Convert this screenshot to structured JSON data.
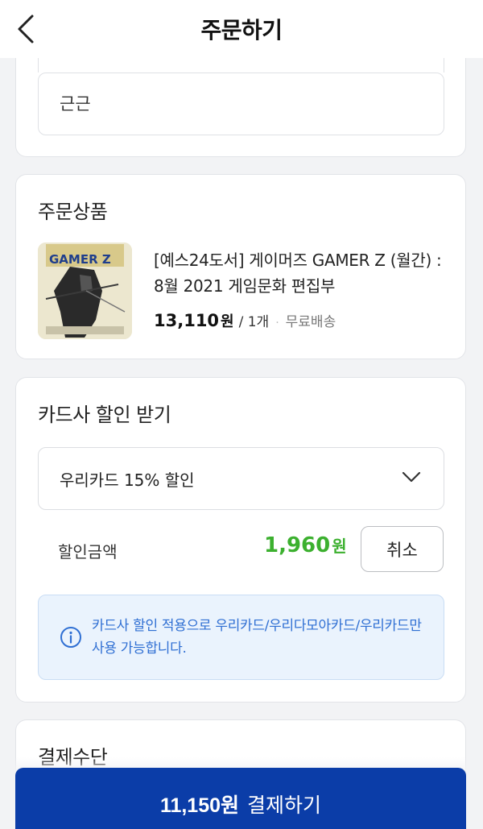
{
  "header": {
    "title": "주문하기",
    "back_icon": "chevron-left-icon"
  },
  "address": {
    "detail": "근근"
  },
  "order": {
    "section_title": "주문상품",
    "product_name": "[예스24도서] 게이머즈 GAMER Z (월간) : 8월 2021 게임문화 편집부",
    "price": "13,110",
    "price_unit": "원",
    "quantity": "/ 1개",
    "separator": "·",
    "shipping": "무료배송",
    "thumbnail_logo": "GAMER Z"
  },
  "discount": {
    "section_title": "카드사 할인 받기",
    "selected_option": "우리카드 15% 할인",
    "amount_label": "할인금액",
    "amount": "1,960",
    "amount_unit": "원",
    "cancel_label": "취소",
    "info_text": "카드사 할인 적용으로 우리카드/우리다모아카드/우리카드만 사용 가능합니다.",
    "amount_color": "#3cb02f",
    "info_color": "#2f6fd3"
  },
  "payment": {
    "section_title": "결제수단",
    "total": "11,150원",
    "button_label": "결제하기",
    "button_color": "#0b3da8"
  }
}
